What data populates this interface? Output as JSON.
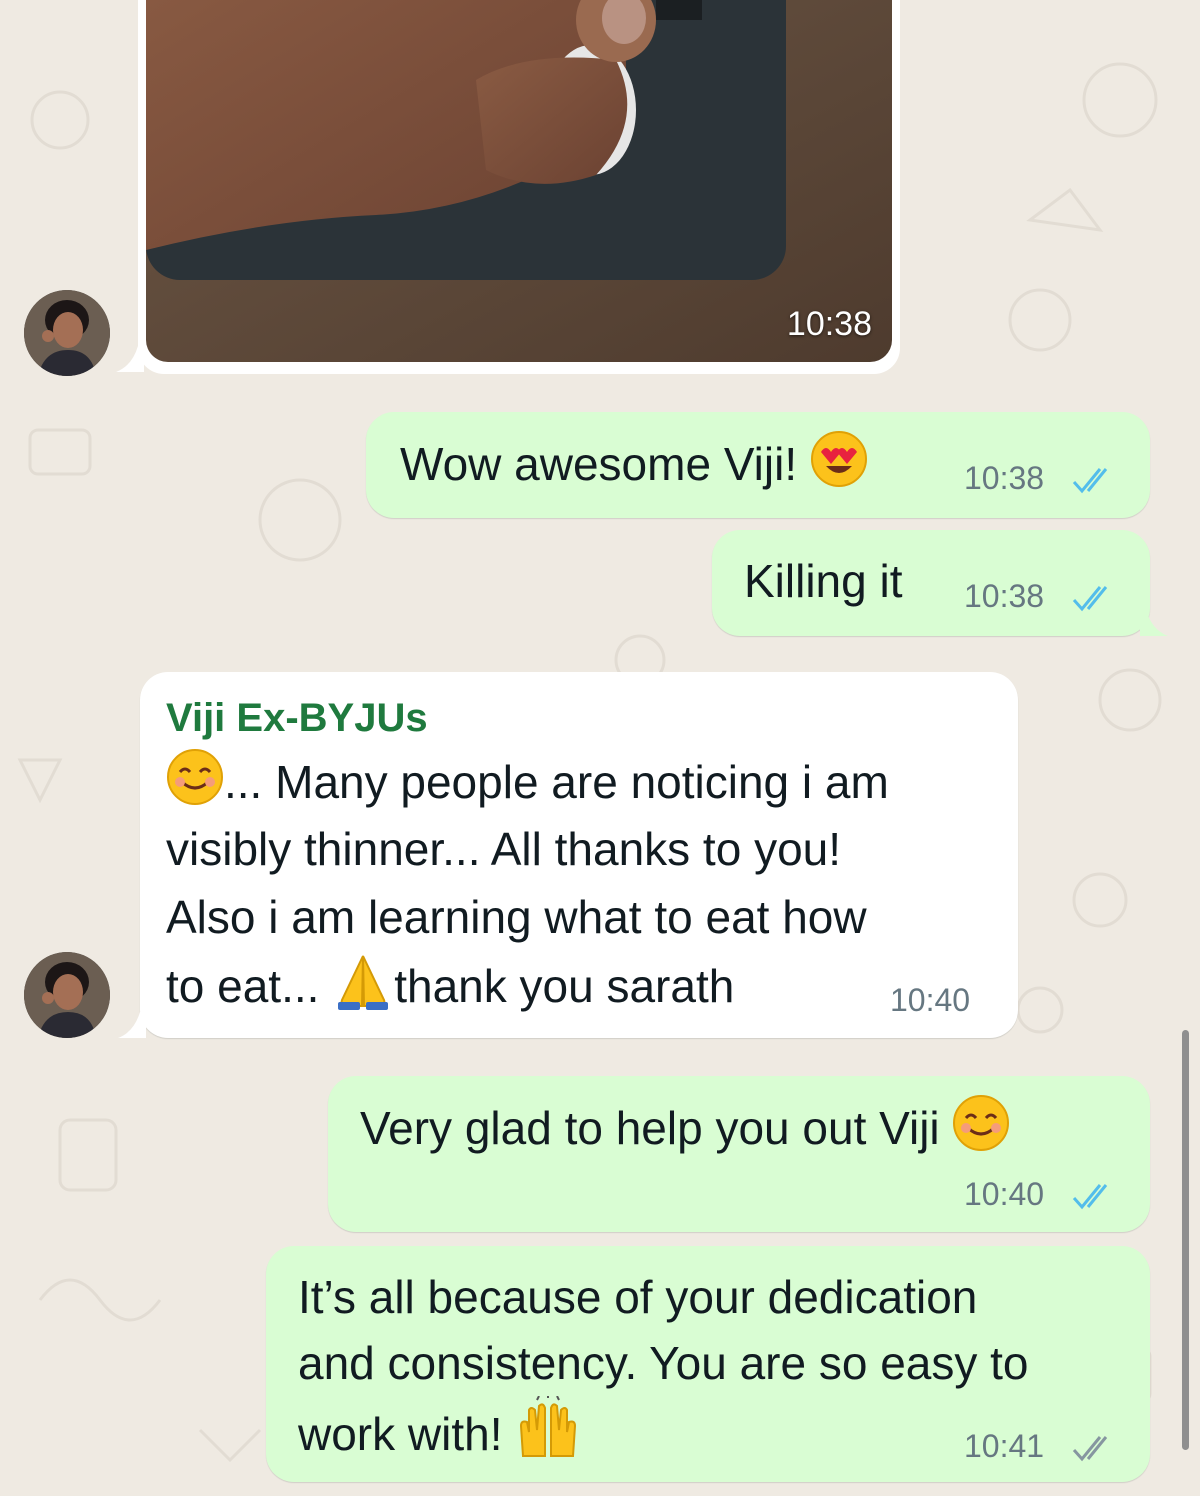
{
  "contact": {
    "name": "Viji Ex-BYJUs"
  },
  "photo": {
    "time": "10:38",
    "icon": "photo-of-foot-on-scale"
  },
  "messages": [
    {
      "text": "Wow awesome Viji!",
      "emoji": "heart-eyes-emoji",
      "time": "10:38",
      "status": "read"
    },
    {
      "text": "Killing it",
      "time": "10:38",
      "status": "read"
    },
    {
      "sender": "Viji Ex-BYJUs",
      "lines": [
        "... Many people are noticing i am",
        "visibly thinner... All thanks to you!",
        "Also i am learning what to eat how",
        "to eat...",
        "thank you sarath"
      ],
      "emojis": [
        "smiling-emoji",
        "folded-hands-emoji"
      ],
      "time": "10:40"
    },
    {
      "text": "Very glad to help you out Viji",
      "emoji": "smiling-emoji",
      "time": "10:40",
      "status": "read"
    },
    {
      "lines": [
        "It’s all because of your dedication",
        "and consistency. You are so easy to",
        "work with!"
      ],
      "emoji": "raising-hands-emoji",
      "time": "10:41",
      "status": "delivered"
    }
  ],
  "colors": {
    "background": "#efeae2",
    "outgoing": "#d9fdd3",
    "incoming": "#ffffff",
    "read_ticks": "#53bdeb",
    "sender_name": "#1f7a3e"
  }
}
